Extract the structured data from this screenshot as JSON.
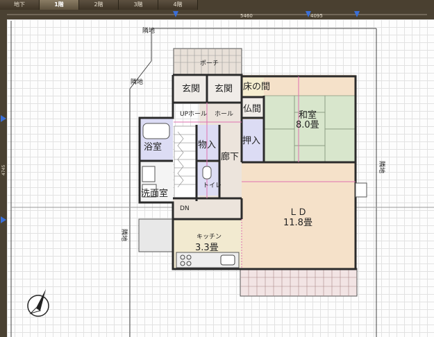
{
  "floor_tabs": [
    {
      "label": "地下",
      "active": false
    },
    {
      "label": "1階",
      "active": true
    },
    {
      "label": "2階",
      "active": false
    },
    {
      "label": "3階",
      "active": false
    },
    {
      "label": "4階",
      "active": false
    }
  ],
  "dimensions": {
    "top_width": "5460",
    "top_right": "4095",
    "left_height": "4745"
  },
  "neighbors": {
    "top": "隣地",
    "top_left": "隣地",
    "left": "隣地",
    "right": "隣地"
  },
  "rooms": {
    "porch": "ポーチ",
    "entrance_left": "玄関",
    "entrance_right": "玄関",
    "tokonoma": "床の間",
    "butsuma": "仏間",
    "washitsu": "和室",
    "washitsu_size": "8.0畳",
    "up_hall": "UPホール",
    "hall": "ホール",
    "bath": "浴室",
    "storage": "物入",
    "corridor": "廊下",
    "closet": "押入",
    "toilet": "トイレ",
    "washroom": "洗面室",
    "ld": "ＬＤ",
    "ld_size": "11.8畳",
    "dn": "DN",
    "kitchen": "キッチン",
    "kitchen_size": "3.3畳"
  },
  "colors": {
    "wall": "#2b2b2b",
    "ld_floor": "#f5e1c9",
    "tatami": "#d8e6cc",
    "closet": "#dcdcf4",
    "corridor": "#ece4dc",
    "kitchen": "#f2ead0",
    "deck": "#e8e0d8",
    "accent_line": "#e070b0",
    "marker": "#3a6fd8"
  },
  "compass": "compass-rose"
}
